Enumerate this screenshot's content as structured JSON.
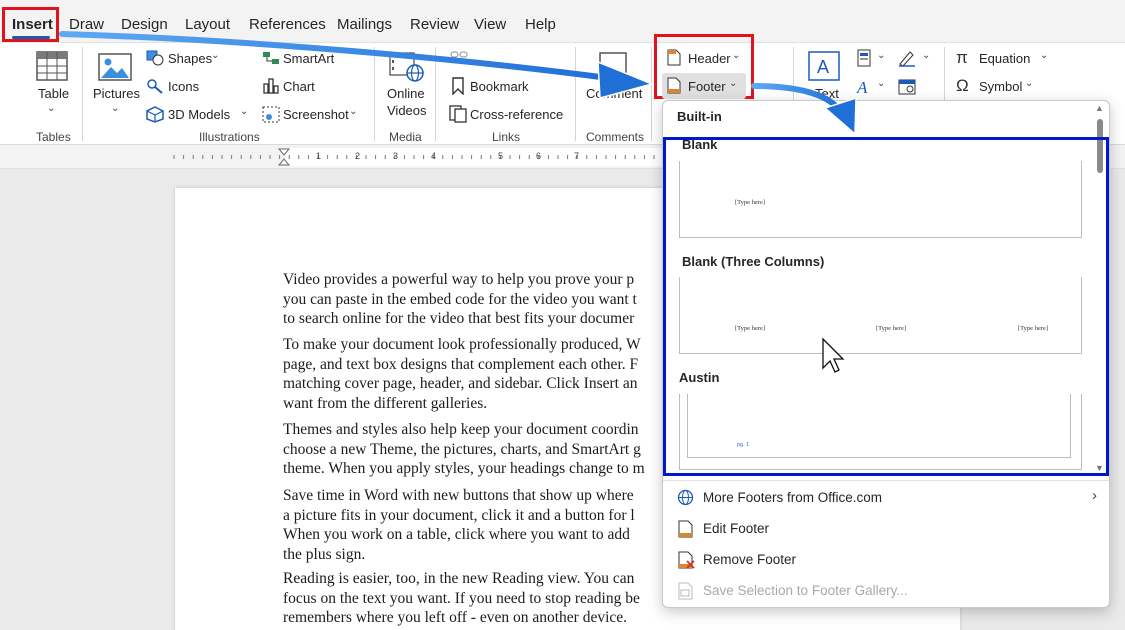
{
  "tabs": [
    "Insert",
    "Draw",
    "Design",
    "Layout",
    "References",
    "Mailings",
    "Review",
    "View",
    "Help"
  ],
  "ribbon": {
    "tables": {
      "table": "Table",
      "group": "Tables"
    },
    "illustrations": {
      "pictures": "Pictures",
      "shapes": "Shapes",
      "icons": "Icons",
      "models": "3D Models",
      "smartart": "SmartArt",
      "chart": "Chart",
      "screenshot": "Screenshot",
      "group": "Illustrations"
    },
    "media": {
      "online": "Online",
      "videos": "Videos",
      "group": "Media"
    },
    "links": {
      "bookmark": "Bookmark",
      "crossref": "Cross-reference",
      "group": "Links"
    },
    "comments": {
      "comment": "Comment",
      "group": "Comments"
    },
    "headerfooter": {
      "header": "Header",
      "footer": "Footer"
    },
    "text": {
      "text": "Text"
    },
    "symbols": {
      "equation": "Equation",
      "symbol": "Symbol"
    }
  },
  "ruler": [
    "1",
    "2",
    "3",
    "4",
    "5",
    "6",
    "7"
  ],
  "document": {
    "paragraphs": [
      "Video provides a powerful way to help you prove your p\nyou can paste in the embed code for the video you want t\nto search online for the video that best fits your documer",
      "To make your document look professionally produced, W\npage, and text box designs that complement each other. F\nmatching cover page, header, and sidebar. Click Insert an\nwant from the different galleries.",
      "Themes and styles also help keep your document coordin\nchoose a new Theme, the pictures, charts, and SmartArt g\ntheme. When you apply styles, your headings change to m",
      "Save time in Word with new buttons that show up where\na picture fits in your document, click it and a button for l\nWhen you work on a table, click where you want to add\nthe plus sign.",
      "Reading is easier, too, in the new Reading view. You can\nfocus on the text you want. If you need to stop reading be\nremembers where you left off - even on another device."
    ]
  },
  "dropdown": {
    "section": "Built-in",
    "items": [
      {
        "title": "Blank",
        "placeholders": [
          "[Type here]"
        ]
      },
      {
        "title": "Blank (Three Columns)",
        "placeholders": [
          "[Type here]",
          "[Type here]",
          "[Type here]"
        ]
      },
      {
        "title": "Austin",
        "placeholders": [
          "pg. 1"
        ]
      }
    ],
    "menu": {
      "more": "More Footers from Office.com",
      "edit": "Edit Footer",
      "remove": "Remove Footer",
      "save": "Save Selection to Footer Gallery..."
    }
  },
  "colors": {
    "highlight_red": "#e1141e",
    "highlight_blue": "#0019cc",
    "arrow_blue": "#1f7ae0",
    "accent": "#1a5bb8"
  }
}
